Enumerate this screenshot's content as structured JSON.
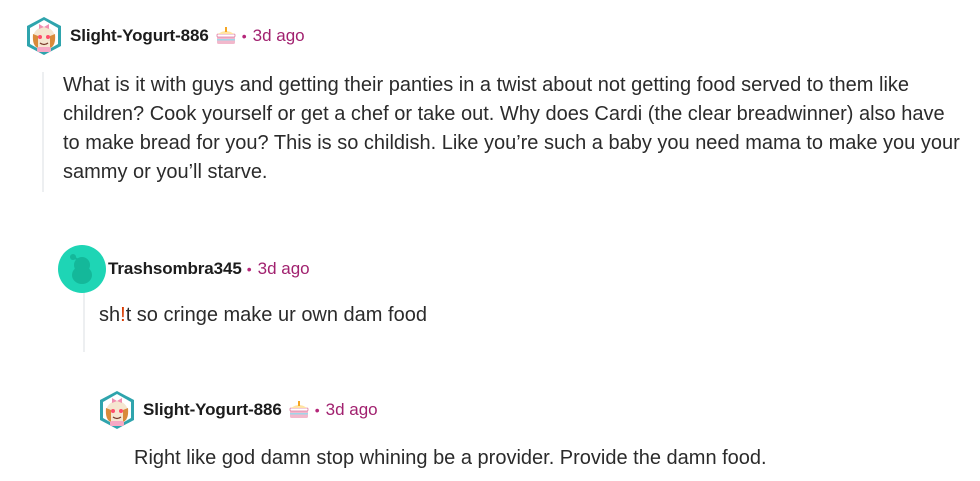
{
  "comments": [
    {
      "username": "Slight-Yogurt-886",
      "separator": "•",
      "timestamp": "3d ago",
      "avatar_icon": "snoo-avatar-bow-icon",
      "flair_icon": "cake-flair-icon",
      "body": "What is it with guys and getting their panties in a twist about not getting food served to them like children? Cook yourself or get a chef or take out. Why does Cardi (the clear breadwinner) also have to make bread for you? This is so childish. Like you’re such a baby you need mama to make you your sammy or you’ll starve."
    },
    {
      "username": "Trashsombra345",
      "separator": "•",
      "timestamp": "3d ago",
      "avatar_icon": "default-snoo-avatar-icon",
      "body_before": "sh",
      "body_censored": "!",
      "body_after": "t so cringe make ur own dam food"
    },
    {
      "username": "Slight-Yogurt-886",
      "separator": "•",
      "timestamp": "3d ago",
      "avatar_icon": "snoo-avatar-bow-icon",
      "flair_icon": "cake-flair-icon",
      "body": "Right like god damn stop whining be a provider. Provide the damn food."
    }
  ],
  "colors": {
    "timestamp": "#a1216f",
    "thread_line": "#edeff1",
    "default_avatar": "#1ed5b5",
    "censor_mark": "#d93a00"
  }
}
